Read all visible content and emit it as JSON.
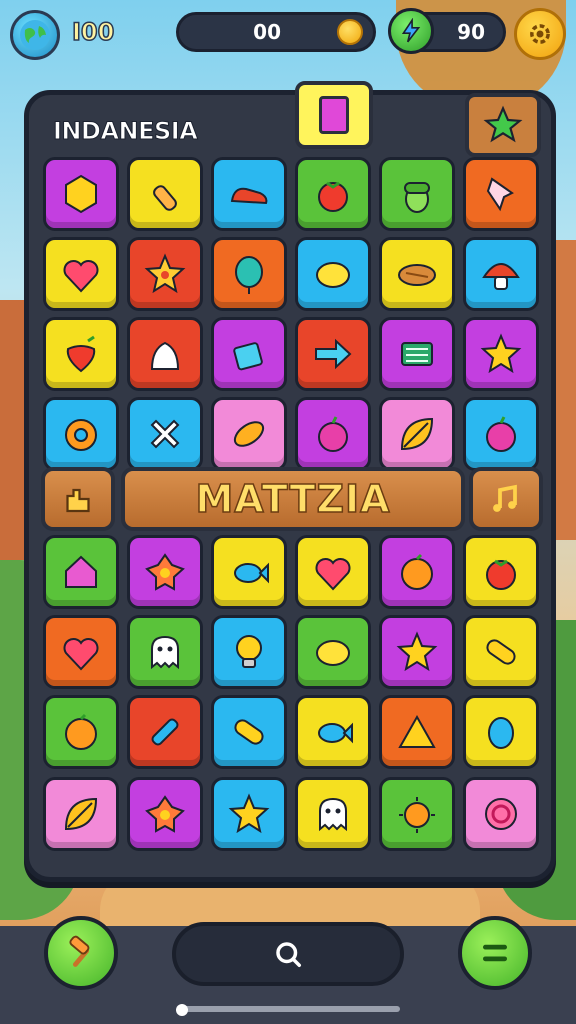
{
  "hud": {
    "level": "I00",
    "coins": "00",
    "energy": "90",
    "icons": {
      "globe": "globe-icon",
      "coin": "coin-icon",
      "energy": "lightning-icon",
      "settings": "gear-icon"
    }
  },
  "board": {
    "title": "INDANESIA",
    "banner_text": "MATTZIA",
    "badges": {
      "center": "card-icon",
      "right": "star-icon"
    },
    "banner_side_icons": {
      "left": "building-icon",
      "right": "music-note-icon"
    },
    "rows": [
      [
        {
          "color": "#c33fe0",
          "icon": "hexagon"
        },
        {
          "color": "#f5e020",
          "icon": "bottle"
        },
        {
          "color": "#2bb8f0",
          "icon": "shoe"
        },
        {
          "color": "#5ac33a",
          "icon": "tomato"
        },
        {
          "color": "#5ac33a",
          "icon": "acorn"
        },
        {
          "color": "#f06a22",
          "icon": "pushpin"
        }
      ],
      [
        {
          "color": "#f5e020",
          "icon": "heart"
        },
        {
          "color": "#e8452a",
          "icon": "star-fruit"
        },
        {
          "color": "#f06a22",
          "icon": "balloon"
        },
        {
          "color": "#2bb8f0",
          "icon": "lemon"
        },
        {
          "color": "#f5e020",
          "icon": "bread"
        },
        {
          "color": "#2bb8f0",
          "icon": "mushroom"
        }
      ],
      [
        {
          "color": "#f5e020",
          "icon": "strawberry"
        },
        {
          "color": "#e8452a",
          "icon": "bag"
        },
        {
          "color": "#c33fe0",
          "icon": "box"
        },
        {
          "color": "#e8452a",
          "icon": "arrow"
        },
        {
          "color": "#c33fe0",
          "icon": "book"
        },
        {
          "color": "#c33fe0",
          "icon": "star"
        }
      ],
      [
        {
          "color": "#2bb8f0",
          "icon": "donut"
        },
        {
          "color": "#2bb8f0",
          "icon": "cross"
        },
        {
          "color": "#f28ad8",
          "icon": "candy"
        },
        {
          "color": "#c33fe0",
          "icon": "apple"
        },
        {
          "color": "#f28ad8",
          "icon": "leaf"
        },
        {
          "color": "#2bb8f0",
          "icon": "apple"
        }
      ],
      [
        {
          "color": "#5ac33a",
          "icon": "house"
        },
        {
          "color": "#c33fe0",
          "icon": "star-shape"
        },
        {
          "color": "#f5e020",
          "icon": "fish"
        },
        {
          "color": "#f5e020",
          "icon": "heart"
        },
        {
          "color": "#c33fe0",
          "icon": "orange"
        },
        {
          "color": "#f5e020",
          "icon": "tomato"
        }
      ],
      [
        {
          "color": "#f06a22",
          "icon": "heart"
        },
        {
          "color": "#5ac33a",
          "icon": "ghost"
        },
        {
          "color": "#2bb8f0",
          "icon": "bulb"
        },
        {
          "color": "#5ac33a",
          "icon": "lemon"
        },
        {
          "color": "#c33fe0",
          "icon": "star"
        },
        {
          "color": "#f5e020",
          "icon": "capsule"
        }
      ],
      [
        {
          "color": "#5ac33a",
          "icon": "orange"
        },
        {
          "color": "#e8452a",
          "icon": "crayon"
        },
        {
          "color": "#2bb8f0",
          "icon": "capsule"
        },
        {
          "color": "#f5e020",
          "icon": "fish"
        },
        {
          "color": "#f06a22",
          "icon": "cheese"
        },
        {
          "color": "#f5e020",
          "icon": "egg"
        }
      ],
      [
        {
          "color": "#f28ad8",
          "icon": "leaf"
        },
        {
          "color": "#c33fe0",
          "icon": "star-shape"
        },
        {
          "color": "#2bb8f0",
          "icon": "star"
        },
        {
          "color": "#f5e020",
          "icon": "ghost"
        },
        {
          "color": "#5ac33a",
          "icon": "sun"
        },
        {
          "color": "#f28ad8",
          "icon": "target"
        }
      ]
    ]
  },
  "controls": {
    "left_button_icon": "hammer-icon",
    "search_icon": "search-icon",
    "menu_icon": "menu-icon"
  }
}
